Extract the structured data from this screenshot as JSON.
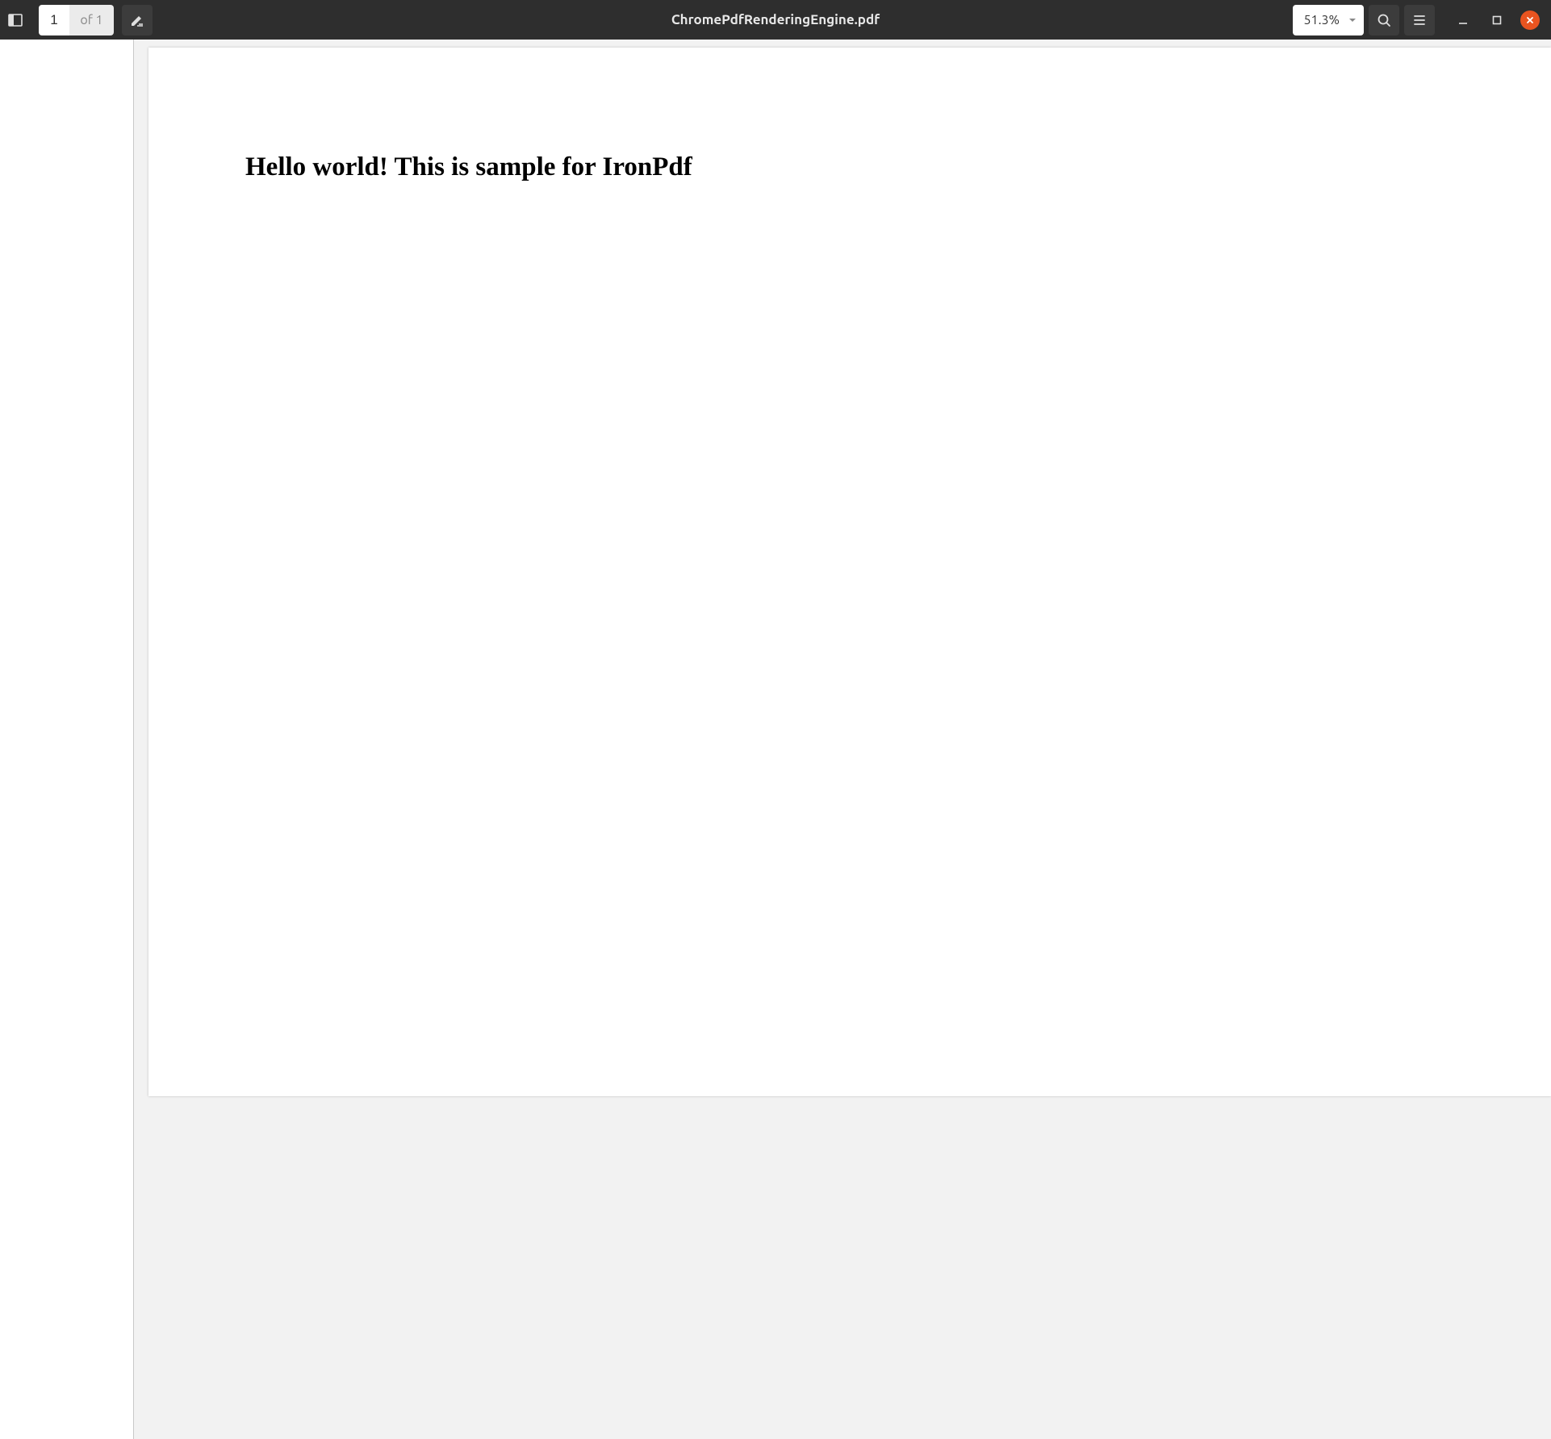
{
  "toolbar": {
    "document_title": "ChromePdfRenderingEngine.pdf",
    "page_current": "1",
    "page_total_label": "of 1",
    "zoom_value": "51.3%"
  },
  "document": {
    "heading": "Hello world! This is sample for IronPdf"
  }
}
